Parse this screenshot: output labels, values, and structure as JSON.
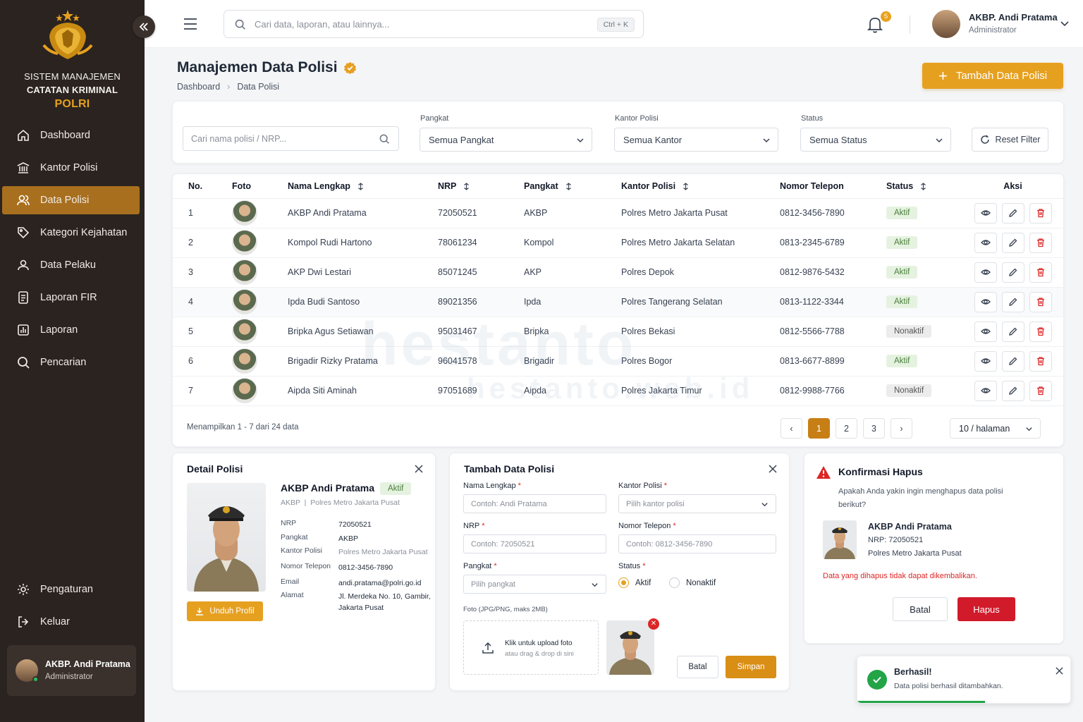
{
  "sidebar": {
    "brand_line1": "SISTEM MANAJEMEN",
    "brand_line2": "CATATAN KRIMINAL",
    "brand_line3": "POLRI",
    "items": [
      {
        "label": "Dashboard",
        "icon": "home-icon"
      },
      {
        "label": "Kantor Polisi",
        "icon": "building-icon"
      },
      {
        "label": "Data Polisi",
        "icon": "users-icon",
        "active": true
      },
      {
        "label": "Kategori Kejahatan",
        "icon": "tag-icon"
      },
      {
        "label": "Data Pelaku",
        "icon": "user-icon"
      },
      {
        "label": "Laporan FIR",
        "icon": "document-icon"
      },
      {
        "label": "Laporan",
        "icon": "chart-icon"
      },
      {
        "label": "Pencarian",
        "icon": "search-icon"
      }
    ],
    "bottom_items": [
      {
        "label": "Pengaturan",
        "icon": "gear-icon"
      },
      {
        "label": "Keluar",
        "icon": "logout-icon"
      }
    ],
    "user": {
      "name": "AKBP. Andi Pratama",
      "role": "Administrator"
    }
  },
  "topbar": {
    "search_placeholder": "Cari data, laporan, atau lainnya...",
    "shortcut": "Ctrl + K",
    "notification_count": "5",
    "user": {
      "name": "AKBP. Andi Pratama",
      "role": "Administrator"
    }
  },
  "page": {
    "title": "Manajemen Data Polisi",
    "breadcrumb": [
      "Dashboard",
      "Data Polisi"
    ],
    "add_button": "Tambah Data Polisi"
  },
  "filters": {
    "search_placeholder": "Cari nama polisi / NRP...",
    "pangkat": {
      "label": "Pangkat",
      "value": "Semua Pangkat"
    },
    "kantor": {
      "label": "Kantor Polisi",
      "value": "Semua Kantor"
    },
    "status": {
      "label": "Status",
      "value": "Semua Status"
    },
    "reset": "Reset Filter"
  },
  "table": {
    "headers": [
      "No.",
      "Foto",
      "Nama Lengkap",
      "NRP",
      "Pangkat",
      "Kantor Polisi",
      "Nomor Telepon",
      "Status",
      "Aksi"
    ],
    "rows": [
      {
        "no": "1",
        "nama": "AKBP Andi Pratama",
        "nrp": "72050521",
        "pangkat": "AKBP",
        "kantor": "Polres Metro Jakarta Pusat",
        "telepon": "0812-3456-7890",
        "status": "Aktif"
      },
      {
        "no": "2",
        "nama": "Kompol Rudi Hartono",
        "nrp": "78061234",
        "pangkat": "Kompol",
        "kantor": "Polres Metro Jakarta Selatan",
        "telepon": "0813-2345-6789",
        "status": "Aktif"
      },
      {
        "no": "3",
        "nama": "AKP Dwi Lestari",
        "nrp": "85071245",
        "pangkat": "AKP",
        "kantor": "Polres Depok",
        "telepon": "0812-9876-5432",
        "status": "Aktif"
      },
      {
        "no": "4",
        "nama": "Ipda Budi Santoso",
        "nrp": "89021356",
        "pangkat": "Ipda",
        "kantor": "Polres Tangerang Selatan",
        "telepon": "0813-1122-3344",
        "status": "Aktif"
      },
      {
        "no": "5",
        "nama": "Bripka Agus Setiawan",
        "nrp": "95031467",
        "pangkat": "Bripka",
        "kantor": "Polres Bekasi",
        "telepon": "0812-5566-7788",
        "status": "Nonaktif"
      },
      {
        "no": "6",
        "nama": "Brigadir Rizky Pratama",
        "nrp": "96041578",
        "pangkat": "Brigadir",
        "kantor": "Polres Bogor",
        "telepon": "0813-6677-8899",
        "status": "Aktif"
      },
      {
        "no": "7",
        "nama": "Aipda Siti Aminah",
        "nrp": "97051689",
        "pangkat": "Aipda",
        "kantor": "Polres Jakarta Timur",
        "telepon": "0812-9988-7766",
        "status": "Nonaktif"
      }
    ],
    "footer": "Menampilkan 1 - 7 dari 24 data",
    "pages": [
      "1",
      "2",
      "3"
    ],
    "per_page": "10 / halaman"
  },
  "watermark": {
    "line1": "hestanto",
    "line2": "hestanto.web.id"
  },
  "detail": {
    "title": "Detail Polisi",
    "name": "AKBP Andi Pratama",
    "status": "Aktif",
    "sub_rank": "AKBP",
    "sub_office": "Polres Metro Jakarta Pusat",
    "fields": [
      {
        "label": "NRP",
        "value": "72050521"
      },
      {
        "label": "Pangkat",
        "value": "AKBP"
      },
      {
        "label": "Kantor Polisi",
        "value": "Polres Metro Jakarta Pusat"
      },
      {
        "label": "Nomor Telepon",
        "value": "0812-3456-7890"
      },
      {
        "label": "Email",
        "value": "andi.pratama@polri.go.id"
      },
      {
        "label": "Alamat",
        "value": "Jl. Merdeka No. 10, Gambir, Jakarta Pusat"
      }
    ],
    "download": "Unduh Profil"
  },
  "add_form": {
    "title": "Tambah Data Polisi",
    "nama": {
      "label": "Nama Lengkap",
      "placeholder": "Contoh: Andi Pratama"
    },
    "kantor": {
      "label": "Kantor Polisi",
      "placeholder": "Pilih kantor polisi"
    },
    "nrp": {
      "label": "NRP",
      "placeholder": "Contoh: 72050521"
    },
    "telepon": {
      "label": "Nomor Telepon",
      "placeholder": "Contoh: 0812-3456-7890"
    },
    "pangkat": {
      "label": "Pangkat",
      "placeholder": "Pilih pangkat"
    },
    "status": {
      "label": "Status",
      "options": [
        "Aktif",
        "Nonaktif"
      ],
      "selected": "Aktif"
    },
    "foto_label": "Foto (JPG/PNG, maks 2MB)",
    "upload_line1": "Klik untuk upload foto",
    "upload_line2": "atau drag & drop di sini",
    "cancel": "Batal",
    "save": "Simpan"
  },
  "confirm": {
    "title": "Konfirmasi Hapus",
    "message": "Apakah Anda yakin ingin menghapus data polisi berikut?",
    "name": "AKBP Andi Pratama",
    "nrp": "NRP: 72050521",
    "kantor": "Polres Metro Jakarta Pusat",
    "warning": "Data yang dihapus tidak dapat dikembalikan.",
    "cancel": "Batal",
    "delete": "Hapus"
  },
  "toast": {
    "title": "Berhasil!",
    "message": "Data polisi berhasil ditambahkan.",
    "progress": 0.6
  },
  "colors": {
    "accent": "#e6a020",
    "sidebar": "#2a2320",
    "danger": "#dc2626",
    "success": "#22a447"
  }
}
